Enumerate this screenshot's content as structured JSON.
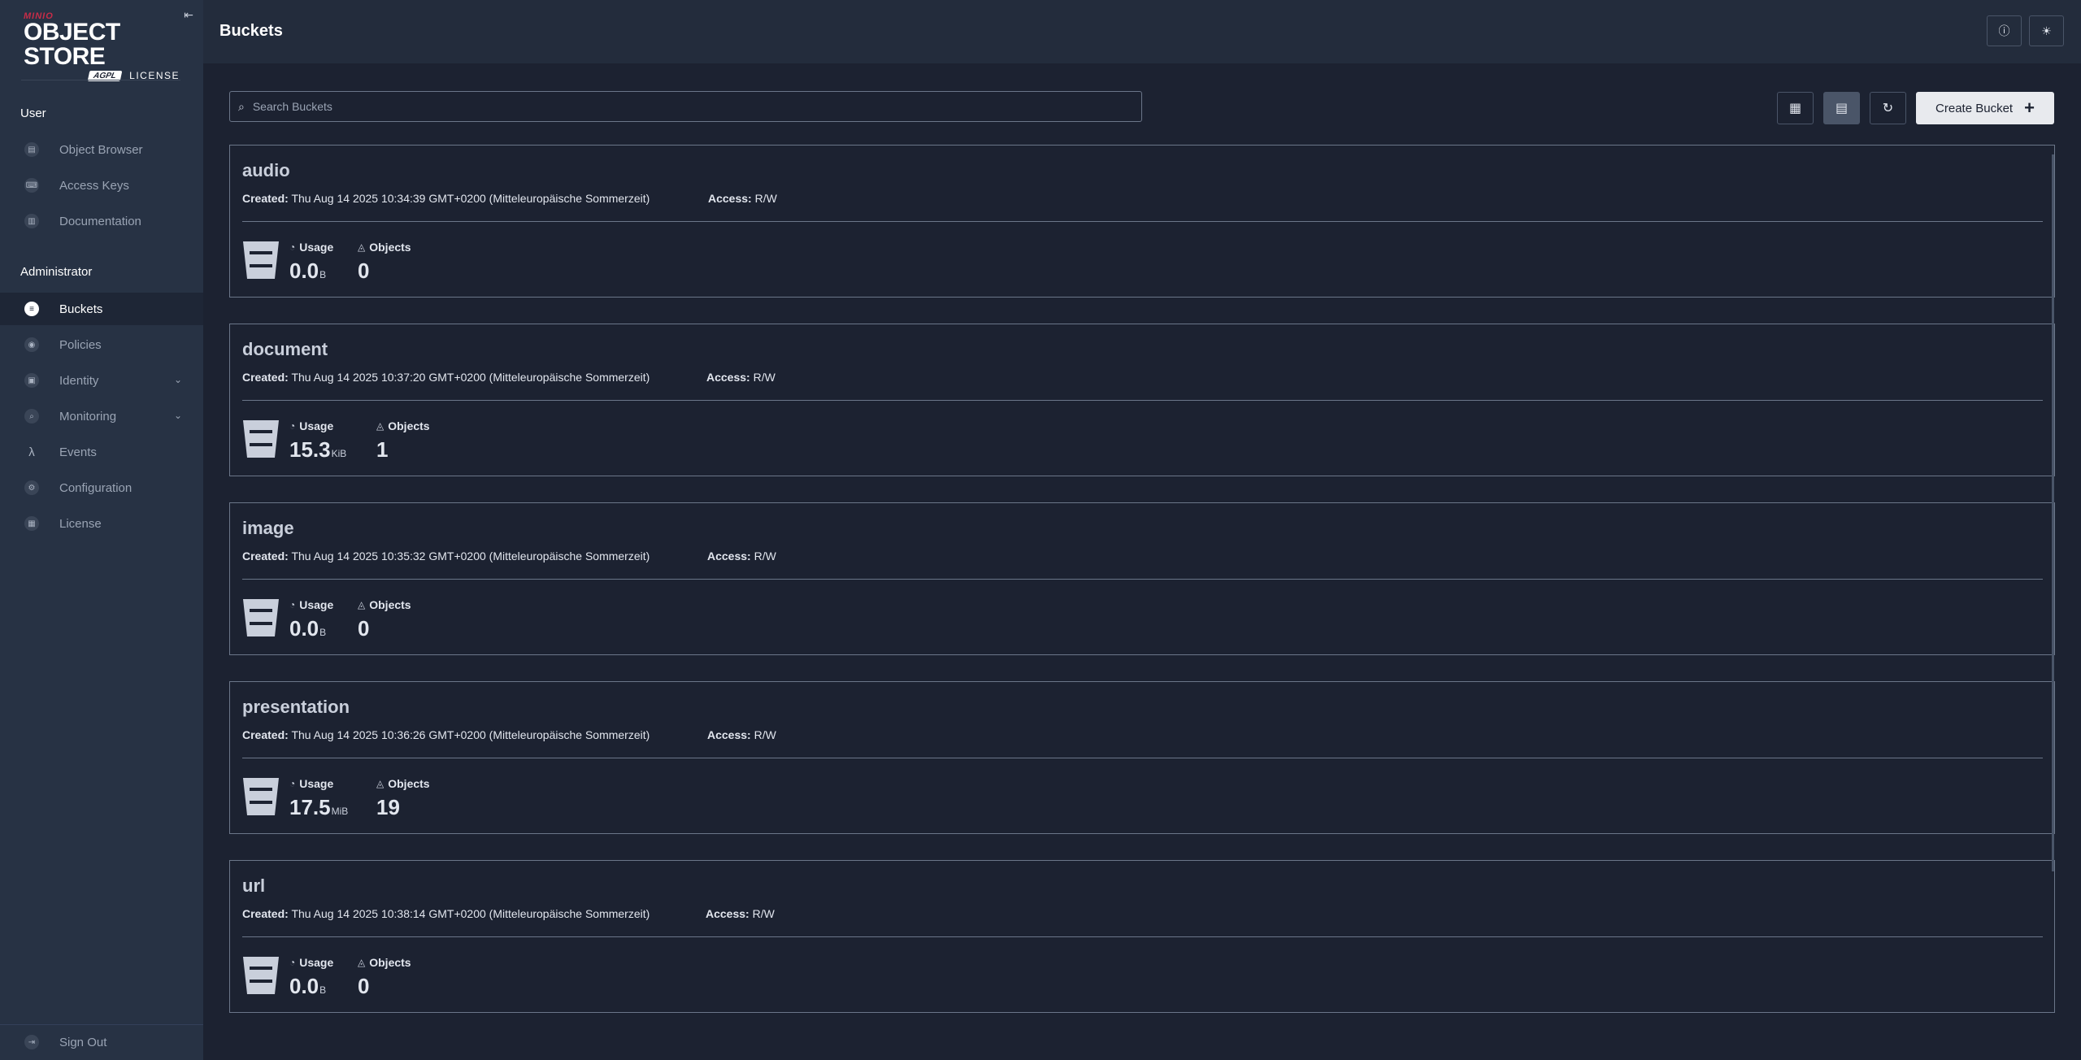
{
  "app": {
    "logo_mini": "MINIO",
    "logo_main": "OBJECT STORE",
    "logo_badge": "AGPL",
    "logo_license": "LICENSE"
  },
  "sidebar": {
    "user_section": "User",
    "user_items": [
      {
        "label": "Object Browser",
        "icon": "object-browser-icon"
      },
      {
        "label": "Access Keys",
        "icon": "access-keys-icon"
      },
      {
        "label": "Documentation",
        "icon": "documentation-icon"
      }
    ],
    "admin_section": "Administrator",
    "admin_items": [
      {
        "label": "Buckets",
        "icon": "buckets-icon",
        "active": true
      },
      {
        "label": "Policies",
        "icon": "policies-icon"
      },
      {
        "label": "Identity",
        "icon": "identity-icon",
        "expandable": true
      },
      {
        "label": "Monitoring",
        "icon": "monitoring-icon",
        "expandable": true
      },
      {
        "label": "Events",
        "icon": "lambda-icon"
      },
      {
        "label": "Configuration",
        "icon": "configuration-icon"
      },
      {
        "label": "License",
        "icon": "license-icon"
      }
    ],
    "sign_out": "Sign Out"
  },
  "header": {
    "title": "Buckets",
    "help_icon": "help-icon",
    "theme_icon": "theme-toggle-icon"
  },
  "toolbar": {
    "search_placeholder": "Search Buckets",
    "create_label": "Create Bucket",
    "view_mode": "list"
  },
  "buckets": [
    {
      "name": "audio",
      "created_label": "Created:",
      "created": "Thu Aug 14 2025 10:34:39 GMT+0200 (Mitteleuropäische Sommerzeit)",
      "access_label": "Access:",
      "access": "R/W",
      "usage_label": "Usage",
      "usage": "0.0",
      "usage_unit": "B",
      "objects_label": "Objects",
      "objects": "0"
    },
    {
      "name": "document",
      "created_label": "Created:",
      "created": "Thu Aug 14 2025 10:37:20 GMT+0200 (Mitteleuropäische Sommerzeit)",
      "access_label": "Access:",
      "access": "R/W",
      "usage_label": "Usage",
      "usage": "15.3",
      "usage_unit": "KiB",
      "objects_label": "Objects",
      "objects": "1"
    },
    {
      "name": "image",
      "created_label": "Created:",
      "created": "Thu Aug 14 2025 10:35:32 GMT+0200 (Mitteleuropäische Sommerzeit)",
      "access_label": "Access:",
      "access": "R/W",
      "usage_label": "Usage",
      "usage": "0.0",
      "usage_unit": "B",
      "objects_label": "Objects",
      "objects": "0"
    },
    {
      "name": "presentation",
      "created_label": "Created:",
      "created": "Thu Aug 14 2025 10:36:26 GMT+0200 (Mitteleuropäische Sommerzeit)",
      "access_label": "Access:",
      "access": "R/W",
      "usage_label": "Usage",
      "usage": "17.5",
      "usage_unit": "MiB",
      "objects_label": "Objects",
      "objects": "19"
    },
    {
      "name": "url",
      "created_label": "Created:",
      "created": "Thu Aug 14 2025 10:38:14 GMT+0200 (Mitteleuropäische Sommerzeit)",
      "access_label": "Access:",
      "access": "R/W",
      "usage_label": "Usage",
      "usage": "0.0",
      "usage_unit": "B",
      "objects_label": "Objects",
      "objects": "0"
    }
  ]
}
